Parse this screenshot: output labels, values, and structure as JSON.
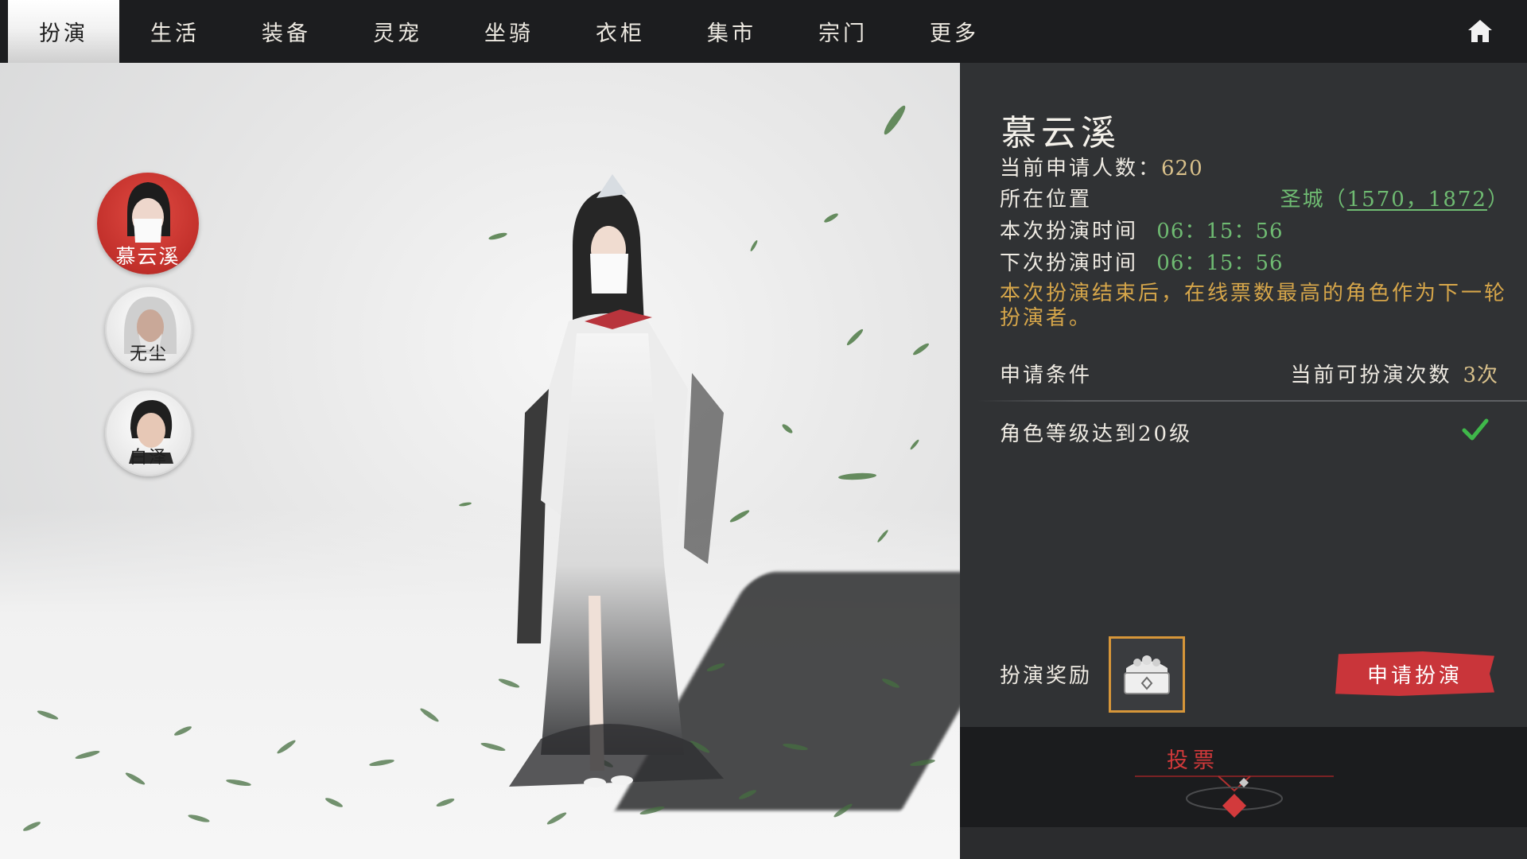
{
  "nav": {
    "tabs": [
      {
        "label": "扮演",
        "active": true
      },
      {
        "label": "生活"
      },
      {
        "label": "装备"
      },
      {
        "label": "灵宠"
      },
      {
        "label": "坐骑"
      },
      {
        "label": "衣柜"
      },
      {
        "label": "集市"
      },
      {
        "label": "宗门"
      },
      {
        "label": "更多"
      }
    ],
    "home_icon": "home-icon"
  },
  "characters": [
    {
      "name": "慕云溪",
      "selected": true
    },
    {
      "name": "无尘"
    },
    {
      "name": "白泽"
    }
  ],
  "panel": {
    "name": "慕云溪",
    "applicants_label": "当前申请人数：",
    "applicants_value": "620",
    "location_label": "所在位置",
    "location_place": "圣城（",
    "location_coords": "1570，1872",
    "location_close": "）",
    "this_time_label": "本次扮演时间",
    "this_time_value": "06：15：56",
    "next_time_label": "下次扮演时间",
    "next_time_value": "06：15：56",
    "note": "本次扮演结束后，在线票数最高的角色作为下一轮扮演者。",
    "condition_header": "申请条件",
    "count_label": "当前可扮演次数",
    "count_value": "3次",
    "condition_item": "角色等级达到20级",
    "reward_label": "扮演奖励",
    "apply_button": "申请扮演",
    "vote_label": "投票"
  },
  "colors": {
    "accent_red": "#c9353a",
    "gold": "#d9c18b",
    "green": "#6fbb72",
    "orange_note": "#d6a64a",
    "panel_bg": "#303234"
  }
}
